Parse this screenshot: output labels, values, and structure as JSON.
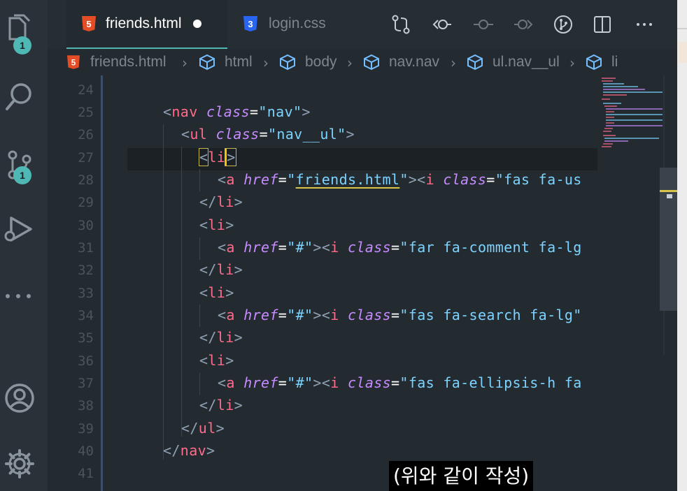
{
  "activity_bar": {
    "explorer_badge": "1",
    "scm_badge": "1"
  },
  "tabs": [
    {
      "label": "friends.html",
      "icon": "html5-icon",
      "active": true,
      "dirty": true
    },
    {
      "label": "login.css",
      "icon": "css3-icon",
      "active": false
    }
  ],
  "breadcrumb": [
    "friends.html",
    "html",
    "body",
    "nav.nav",
    "ul.nav__ul",
    "li"
  ],
  "line_numbers": [
    "24",
    "25",
    "26",
    "27",
    "28",
    "29",
    "30",
    "31",
    "32",
    "33",
    "34",
    "35",
    "36",
    "37",
    "38",
    "39",
    "40",
    "41"
  ],
  "code": {
    "l25_tag": "nav",
    "l25_attr": "class",
    "l25_val": "nav",
    "l26_tag": "ul",
    "l26_attr": "class",
    "l26_val": "nav__ul",
    "l27_tag": "li",
    "l28_tag": "a",
    "l28_attr": "href",
    "l28_val": "friends.html",
    "l28_itag": "i",
    "l28_iattr": "class",
    "l28_ival": "fas fa-us",
    "l29_tag": "li",
    "l30_tag": "li",
    "l31_tag": "a",
    "l31_attr": "href",
    "l31_val": "#",
    "l31_itag": "i",
    "l31_iattr": "class",
    "l31_ival": "far fa-comment fa-lg",
    "l32_tag": "li",
    "l33_tag": "li",
    "l34_tag": "a",
    "l34_attr": "href",
    "l34_val": "#",
    "l34_itag": "i",
    "l34_iattr": "class",
    "l34_ival": "fas fa-search fa-lg",
    "l35_tag": "li",
    "l36_tag": "li",
    "l37_tag": "a",
    "l37_attr": "href",
    "l37_val": "#",
    "l37_itag": "i",
    "l37_iattr": "class",
    "l37_ival": "fas fa-ellipsis-h fa",
    "l38_tag": "li",
    "l39_tag": "ul",
    "l40_tag": "nav"
  },
  "subtitle": "(위와 같이 작성)",
  "colors": {
    "tag": "#ff6b8b",
    "attr": "#c78bff",
    "string": "#7cd3ff",
    "accent": "#4fb8b4"
  }
}
